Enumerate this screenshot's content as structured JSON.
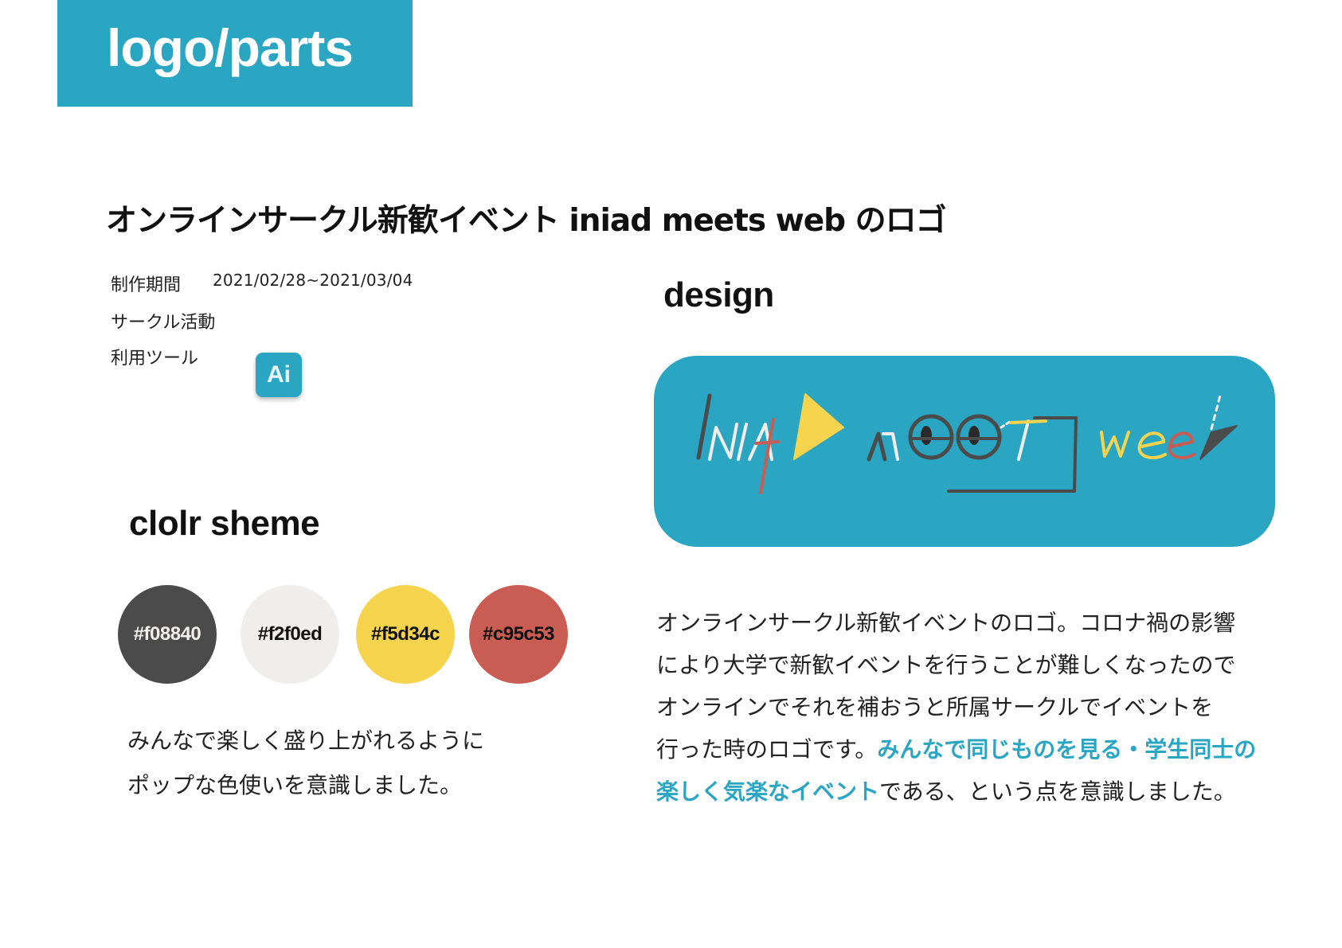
{
  "banner": {
    "title": "logo/parts",
    "color": "#2aa6c2"
  },
  "project": {
    "title": "オンラインサークル新歓イベント iniad meets web のロゴ",
    "period_label": "制作期間",
    "period_value": "2021/02/28~2021/03/04",
    "activity": "サークル活動",
    "tools_label": "利用ツール",
    "tool_badge": "Ai"
  },
  "design": {
    "heading": "design",
    "card_color": "#2aa6c2",
    "description": {
      "line1": "オンラインサークル新歓イベントのロゴ。コロナ禍の影響",
      "line2": "により大学で新歓イベントを行うことが難しくなったので",
      "line3": "オンラインでそれを補おうと所属サークルでイベントを",
      "line4_plain": "行った時のロゴです。",
      "line4_highlight": "みんなで同じものを見る・学生同士の",
      "line5_highlight": "楽しく気楽なイベント",
      "line5_plain": "である、という点を意識しました。"
    }
  },
  "color_scheme": {
    "heading": "clolr sheme",
    "swatches": [
      {
        "label": "#f08840",
        "color": "#4b4b4b"
      },
      {
        "label": "#f2f0ed",
        "color": "#f0eeec"
      },
      {
        "label": "#f5d34c",
        "color": "#f5d34c"
      },
      {
        "label": "#c95c53",
        "color": "#c95c53"
      }
    ],
    "description": {
      "line1": "みんなで楽しく盛り上がれるように",
      "line2": "ポップな色使いを意識しました。"
    }
  }
}
